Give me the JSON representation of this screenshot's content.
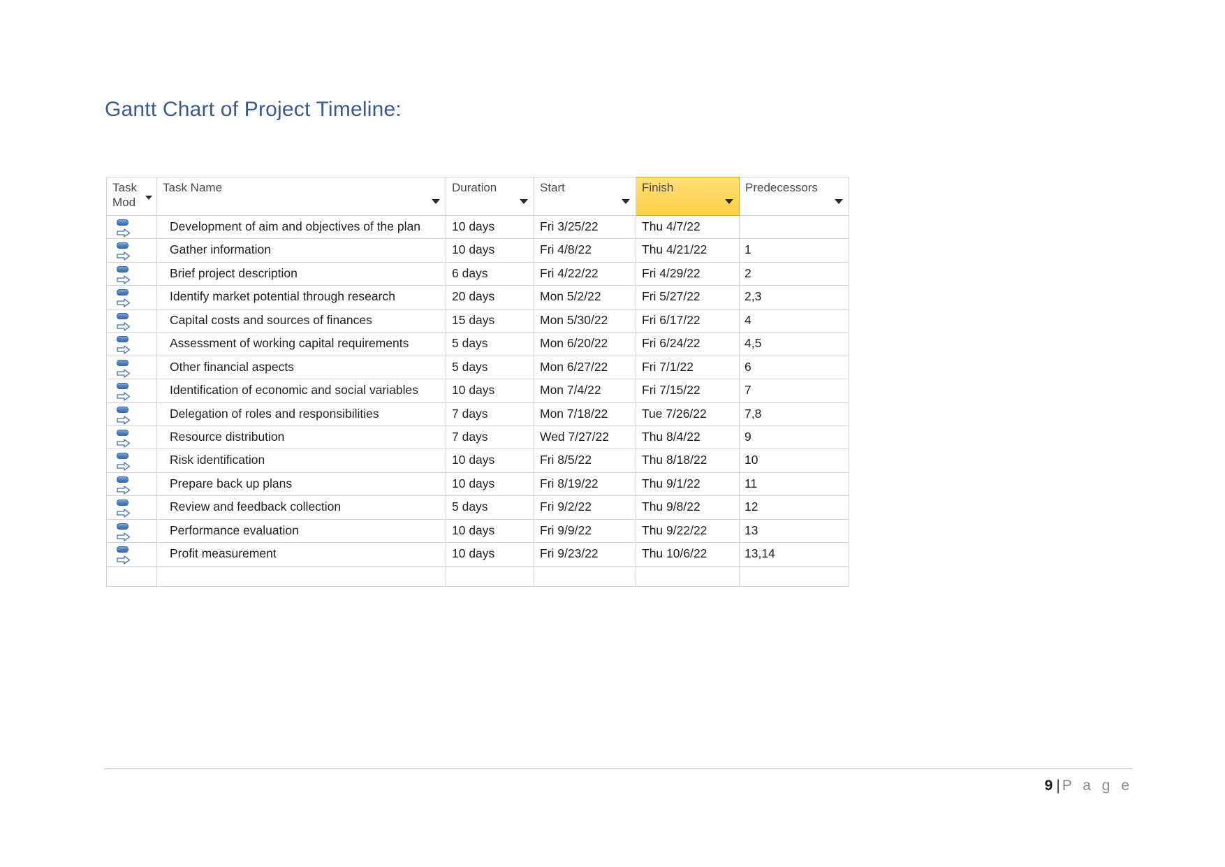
{
  "document": {
    "heading": "Gantt Chart of Project Timeline:",
    "accent_color": "#3A5A8C"
  },
  "table": {
    "highlight_color": "#FFD75E",
    "header_background": "#E6E8EB",
    "columns": [
      {
        "id": "taskmode",
        "label": "Task Mod",
        "highlighted": false
      },
      {
        "id": "taskname",
        "label": "Task Name",
        "highlighted": false
      },
      {
        "id": "duration",
        "label": "Duration",
        "highlighted": false
      },
      {
        "id": "start",
        "label": "Start",
        "highlighted": false
      },
      {
        "id": "finish",
        "label": "Finish",
        "highlighted": true
      },
      {
        "id": "predecessors",
        "label": "Predecessors",
        "highlighted": false
      }
    ],
    "rows": [
      {
        "mode_icon": "auto-scheduled-icon",
        "task_name": "Development of aim and objectives of the plan",
        "duration": "10 days",
        "start": "Fri 3/25/22",
        "finish": "Thu 4/7/22",
        "predecessors": ""
      },
      {
        "mode_icon": "auto-scheduled-icon",
        "task_name": "Gather information",
        "duration": "10 days",
        "start": "Fri 4/8/22",
        "finish": "Thu 4/21/22",
        "predecessors": "1"
      },
      {
        "mode_icon": "auto-scheduled-icon",
        "task_name": "Brief project description",
        "duration": "6 days",
        "start": "Fri 4/22/22",
        "finish": "Fri 4/29/22",
        "predecessors": "2"
      },
      {
        "mode_icon": "auto-scheduled-icon",
        "task_name": "Identify market potential through research",
        "duration": "20 days",
        "start": "Mon 5/2/22",
        "finish": "Fri 5/27/22",
        "predecessors": "2,3"
      },
      {
        "mode_icon": "auto-scheduled-icon",
        "task_name": "Capital costs and sources of finances",
        "duration": "15 days",
        "start": "Mon 5/30/22",
        "finish": "Fri 6/17/22",
        "predecessors": "4"
      },
      {
        "mode_icon": "auto-scheduled-icon",
        "task_name": "Assessment of working capital requirements",
        "duration": "5 days",
        "start": "Mon 6/20/22",
        "finish": "Fri 6/24/22",
        "predecessors": "4,5"
      },
      {
        "mode_icon": "auto-scheduled-icon",
        "task_name": "Other financial aspects",
        "duration": "5 days",
        "start": "Mon 6/27/22",
        "finish": "Fri 7/1/22",
        "predecessors": "6"
      },
      {
        "mode_icon": "auto-scheduled-icon",
        "task_name": "Identification of economic and social variables",
        "duration": "10 days",
        "start": "Mon 7/4/22",
        "finish": "Fri 7/15/22",
        "predecessors": "7"
      },
      {
        "mode_icon": "auto-scheduled-icon",
        "task_name": "Delegation of roles and responsibilities",
        "duration": "7 days",
        "start": "Mon 7/18/22",
        "finish": "Tue 7/26/22",
        "predecessors": "7,8"
      },
      {
        "mode_icon": "auto-scheduled-icon",
        "task_name": "Resource distribution",
        "duration": "7 days",
        "start": "Wed 7/27/22",
        "finish": "Thu 8/4/22",
        "predecessors": "9"
      },
      {
        "mode_icon": "auto-scheduled-icon",
        "task_name": "Risk identification",
        "duration": "10 days",
        "start": "Fri 8/5/22",
        "finish": "Thu 8/18/22",
        "predecessors": "10"
      },
      {
        "mode_icon": "auto-scheduled-icon",
        "task_name": "Prepare back up plans",
        "duration": "10 days",
        "start": "Fri 8/19/22",
        "finish": "Thu 9/1/22",
        "predecessors": "11"
      },
      {
        "mode_icon": "auto-scheduled-icon",
        "task_name": "Review and feedback collection",
        "duration": "5 days",
        "start": "Fri 9/2/22",
        "finish": "Thu 9/8/22",
        "predecessors": "12"
      },
      {
        "mode_icon": "auto-scheduled-icon",
        "task_name": "Performance evaluation",
        "duration": "10 days",
        "start": "Fri 9/9/22",
        "finish": "Thu 9/22/22",
        "predecessors": "13"
      },
      {
        "mode_icon": "auto-scheduled-icon",
        "task_name": "Profit measurement",
        "duration": "10 days",
        "start": "Fri 9/23/22",
        "finish": "Thu 10/6/22",
        "predecessors": "13,14"
      }
    ],
    "trailing_blank_row": true
  },
  "footer": {
    "page_number": "9",
    "separator": "|",
    "label": "P a g e"
  }
}
